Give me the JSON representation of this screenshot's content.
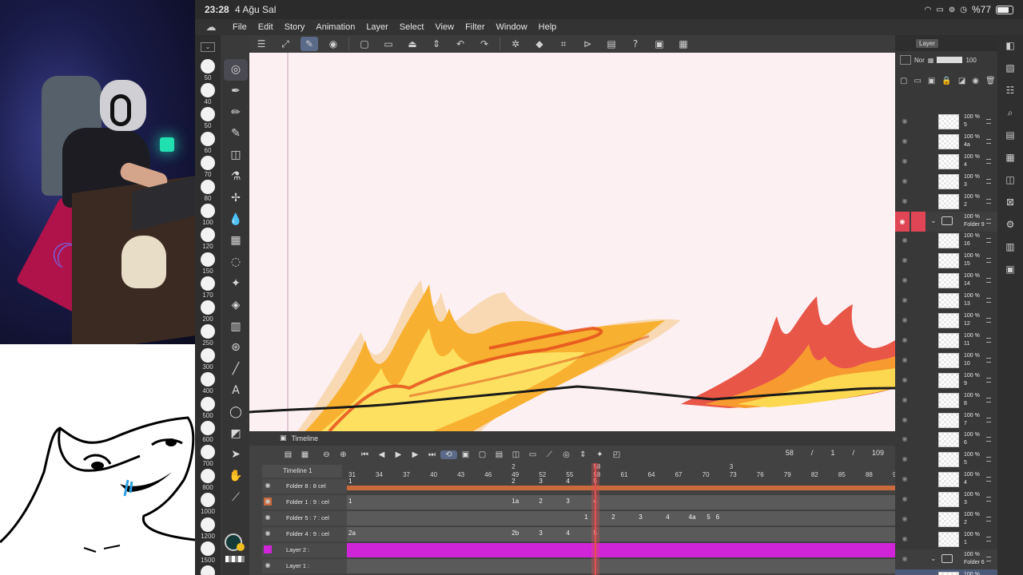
{
  "status_bar": {
    "time": "23:28",
    "date": "4 Ağu Sal",
    "battery": "%77"
  },
  "menu": [
    "File",
    "Edit",
    "Story",
    "Animation",
    "Layer",
    "Select",
    "View",
    "Filter",
    "Window",
    "Help"
  ],
  "toolbar_icons": [
    "menu-icon",
    "fit-canvas-icon",
    "edit-icon",
    "hide-icon",
    "new-file-icon",
    "open-icon",
    "save-icon",
    "save-dropdown-icon",
    "undo-icon",
    "redo-icon",
    "loading-icon",
    "fill-icon",
    "crop-icon",
    "flip-icon",
    "page-icon",
    "help-icon",
    "screenshot-icon",
    "gallery-icon"
  ],
  "brush_sizes": [
    "50",
    "40",
    "50",
    "60",
    "70",
    "80",
    "100",
    "120",
    "150",
    "170",
    "200",
    "250",
    "300",
    "400",
    "500",
    "600",
    "700",
    "800",
    "1000",
    "1200",
    "1500",
    "1700"
  ],
  "tools": [
    "timeline-icon",
    "pen-icon",
    "pencil-icon",
    "brush-icon",
    "eraser-icon",
    "airbrush-icon",
    "decoration-icon",
    "blend-icon",
    "figure-icon",
    "lasso-icon",
    "auto-select-icon",
    "fill-bucket-icon",
    "gradient-icon",
    "magic-wand-icon",
    "ruler-line-icon",
    "text-icon",
    "balloon-icon",
    "frame-icon",
    "object-select-icon",
    "hand-icon",
    "eyedropper-icon"
  ],
  "colors": {
    "main": "#143a3a",
    "sub": "#f0c020",
    "accent_red": "#e04555",
    "selected_magenta": "#d024d8"
  },
  "timeline": {
    "title": "Timeline",
    "name": "Timeline 1",
    "frame_current": "58",
    "frame_sep1": "/",
    "frame_page": "1",
    "frame_sep2": "/",
    "frame_total": "109",
    "ruler": [
      "31",
      "34",
      "37",
      "40",
      "43",
      "46",
      "49",
      "52",
      "55",
      "58",
      "61",
      "64",
      "67",
      "70",
      "73",
      "76",
      "79",
      "82",
      "85",
      "88",
      "9"
    ],
    "ruler_marks": [
      {
        "label": "2",
        "frame": "49"
      },
      {
        "label": "58",
        "frame": "58"
      },
      {
        "label": "3",
        "frame": "73"
      }
    ],
    "tracks": [
      {
        "name": "Folder 8 : 8 cel",
        "cels": [
          {
            "t": "1",
            "f": "31"
          },
          {
            "t": "2",
            "f": "49"
          },
          {
            "t": "3",
            "f": "52"
          },
          {
            "t": "4",
            "f": "55"
          },
          {
            "t": "5",
            "f": "58"
          }
        ]
      },
      {
        "name": "Folder 1 : 9 : cel",
        "cels": [
          {
            "t": "1",
            "f": "31"
          },
          {
            "t": "1a",
            "f": "49"
          },
          {
            "t": "2",
            "f": "52"
          },
          {
            "t": "3",
            "f": "55"
          },
          {
            "t": "4",
            "f": "58"
          }
        ]
      },
      {
        "name": "Folder 5 : 7 : cel",
        "cels": [
          {
            "t": "1",
            "f": "57"
          },
          {
            "t": "2",
            "f": "60"
          },
          {
            "t": "3",
            "f": "63"
          },
          {
            "t": "4",
            "f": "66"
          },
          {
            "t": "4a",
            "f": "68.5"
          },
          {
            "t": "5",
            "f": "70.5"
          },
          {
            "t": "6",
            "f": "71.5"
          }
        ]
      },
      {
        "name": "Folder 4 : 9 : cel",
        "cels": [
          {
            "t": "2a",
            "f": "31"
          },
          {
            "t": "2b",
            "f": "49"
          },
          {
            "t": "3",
            "f": "52"
          },
          {
            "t": "4",
            "f": "55"
          },
          {
            "t": "5",
            "f": "58"
          }
        ]
      },
      {
        "name": "Layer 2 :",
        "cels": []
      },
      {
        "name": "Layer 1 :",
        "cels": []
      }
    ]
  },
  "layers_panel": {
    "tab": "Layer",
    "blend_mode": "Nor",
    "opacity": "100",
    "rows": [
      {
        "pct": "100 %",
        "name": "5",
        "folder": false
      },
      {
        "pct": "100 %",
        "name": "4a",
        "folder": false
      },
      {
        "pct": "100 %",
        "name": "4",
        "folder": false
      },
      {
        "pct": "100 %",
        "name": "3",
        "folder": false
      },
      {
        "pct": "100 %",
        "name": "2",
        "folder": false
      },
      {
        "pct": "100 %",
        "name": "Folder 9",
        "folder": true,
        "red": true
      },
      {
        "pct": "100 %",
        "name": "16",
        "folder": false
      },
      {
        "pct": "100 %",
        "name": "15",
        "folder": false
      },
      {
        "pct": "100 %",
        "name": "14",
        "folder": false
      },
      {
        "pct": "100 %",
        "name": "13",
        "folder": false
      },
      {
        "pct": "100 %",
        "name": "12",
        "folder": false
      },
      {
        "pct": "100 %",
        "name": "11",
        "folder": false
      },
      {
        "pct": "100 %",
        "name": "10",
        "folder": false
      },
      {
        "pct": "100 %",
        "name": "9",
        "folder": false
      },
      {
        "pct": "100 %",
        "name": "8",
        "folder": false
      },
      {
        "pct": "100 %",
        "name": "7",
        "folder": false
      },
      {
        "pct": "100 %",
        "name": "6",
        "folder": false
      },
      {
        "pct": "100 %",
        "name": "5",
        "folder": false
      },
      {
        "pct": "100 %",
        "name": "4",
        "folder": false
      },
      {
        "pct": "100 %",
        "name": "3",
        "folder": false
      },
      {
        "pct": "100 %",
        "name": "2",
        "folder": false
      },
      {
        "pct": "100 %",
        "name": "1",
        "folder": false
      },
      {
        "pct": "100 %",
        "name": "Folder 6",
        "folder": true
      },
      {
        "pct": "100 %",
        "name": "1",
        "folder": false,
        "selected": true
      }
    ]
  },
  "right_icons": [
    "navigator-icon",
    "sub-view-icon",
    "layer-property-icon",
    "search-layer-icon",
    "auto-action-icon",
    "item-bank-icon",
    "color-history-icon",
    "close-panel-icon",
    "material-icon",
    "tool-property-icon",
    "layer-panel-icon"
  ]
}
